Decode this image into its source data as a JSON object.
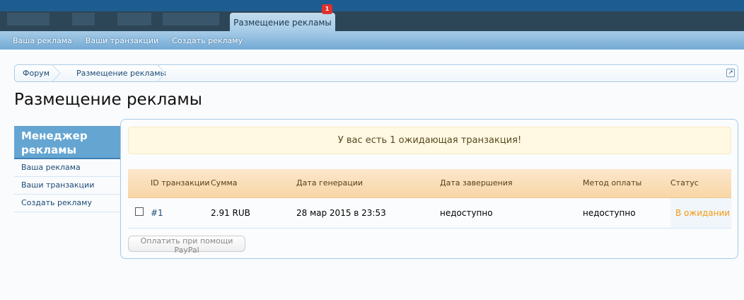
{
  "header": {
    "active_tab": "Размещение рекламы",
    "badge": "1"
  },
  "subnav": [
    "Ваша реклама",
    "Ваши транзакции",
    "Создать рекламу"
  ],
  "breadcrumb": [
    "Форум",
    "Размещение рекламы"
  ],
  "page_title": "Размещение рекламы",
  "sidebar": {
    "title": "Менеджер рекламы",
    "items": [
      "Ваша реклама",
      "Ваши транзакции",
      "Создать рекламу"
    ]
  },
  "notice": "У вас есть 1 ожидающая транзакция!",
  "table": {
    "headers": [
      "ID транзакции",
      "Сумма",
      "Дата генерации",
      "Дата завершения",
      "Метод оплаты",
      "Статус"
    ],
    "rows": [
      {
        "id": "#1",
        "amount": "2.91 RUB",
        "generated": "28 мар 2015 в 23:53",
        "completed": "недоступно",
        "method": "недоступно",
        "status": "В ожидании"
      }
    ]
  },
  "pay_button": "Оплатить при помощи PayPal",
  "colors": {
    "accent": "#65a5d1",
    "status_pending": "#f39a10"
  }
}
